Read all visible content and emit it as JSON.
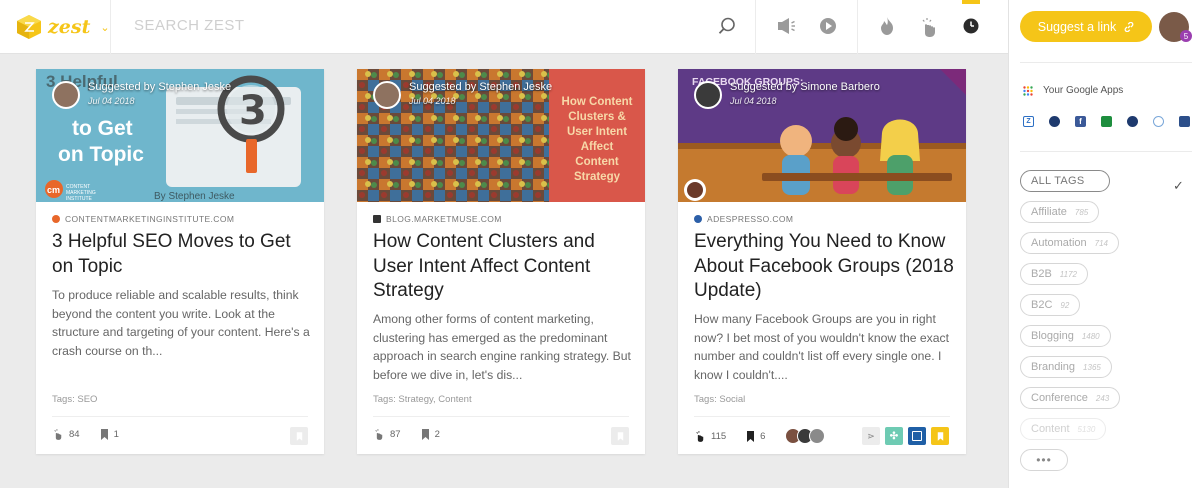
{
  "header": {
    "logo_text": "zest",
    "search_placeholder": "SEARCH ZEST"
  },
  "sidebar": {
    "suggest_button": "Suggest a link",
    "notification_count": "5",
    "google_apps_label": "Your Google Apps",
    "tags": [
      {
        "name": "ALL TAGS",
        "count": "",
        "active": true
      },
      {
        "name": "Affiliate",
        "count": "785"
      },
      {
        "name": "Automation",
        "count": "714"
      },
      {
        "name": "B2B",
        "count": "1172"
      },
      {
        "name": "B2C",
        "count": "92"
      },
      {
        "name": "Blogging",
        "count": "1480"
      },
      {
        "name": "Branding",
        "count": "1365"
      },
      {
        "name": "Conference",
        "count": "243"
      },
      {
        "name": "Content",
        "count": "5130"
      }
    ],
    "more": "•••"
  },
  "cards": [
    {
      "suggested_by": "Suggested by Stephen Jeske",
      "date": "Jul 04 2018",
      "source": "CONTENTMARKETINGINSTITUTE.COM",
      "title": "3 Helpful SEO Moves to Get on Topic",
      "description": "To produce reliable and scalable results, think beyond the content you write. Look at the structure and targeting of your content. Here's a crash course on th...",
      "tags_label": "Tags:",
      "tags": "SEO",
      "claps": "84",
      "saves": "1",
      "image_text": "3 Helpful SEO Moves to Get on Topic",
      "image_byline": "By Stephen Jeske",
      "image_logo": "CONTENT MARKETING INSTITUTE"
    },
    {
      "suggested_by": "Suggested by Stephen Jeske",
      "date": "Jul 04 2018",
      "source": "BLOG.MARKETMUSE.COM",
      "title": "How Content Clusters and User Intent Affect Content Strategy",
      "description": "Among other forms of content marketing, clustering has emerged as the predominant approach in search engine ranking strategy. But before we dive in, let's dis...",
      "tags_label": "Tags:",
      "tags": "Strategy, Content",
      "claps": "87",
      "saves": "2",
      "image_text": "How Content Clusters & User Intent Affect Content Strategy"
    },
    {
      "suggested_by": "Suggested by Simone Barbero",
      "date": "Jul 04 2018",
      "source": "ADESPRESSO.COM",
      "title": "Everything You Need to Know About Facebook Groups (2018 Update)",
      "description": "How many Facebook Groups are you in right now? I bet most of you wouldn't know the exact number and couldn't list off every single one. I know I couldn't....",
      "tags_label": "Tags:",
      "tags": "Social",
      "claps": "115",
      "saves": "6",
      "image_text": "FACEBOOK GROUPS:"
    }
  ],
  "colors": {
    "brand_yellow": "#f5c518",
    "badge_purple": "#9b3fb0"
  }
}
